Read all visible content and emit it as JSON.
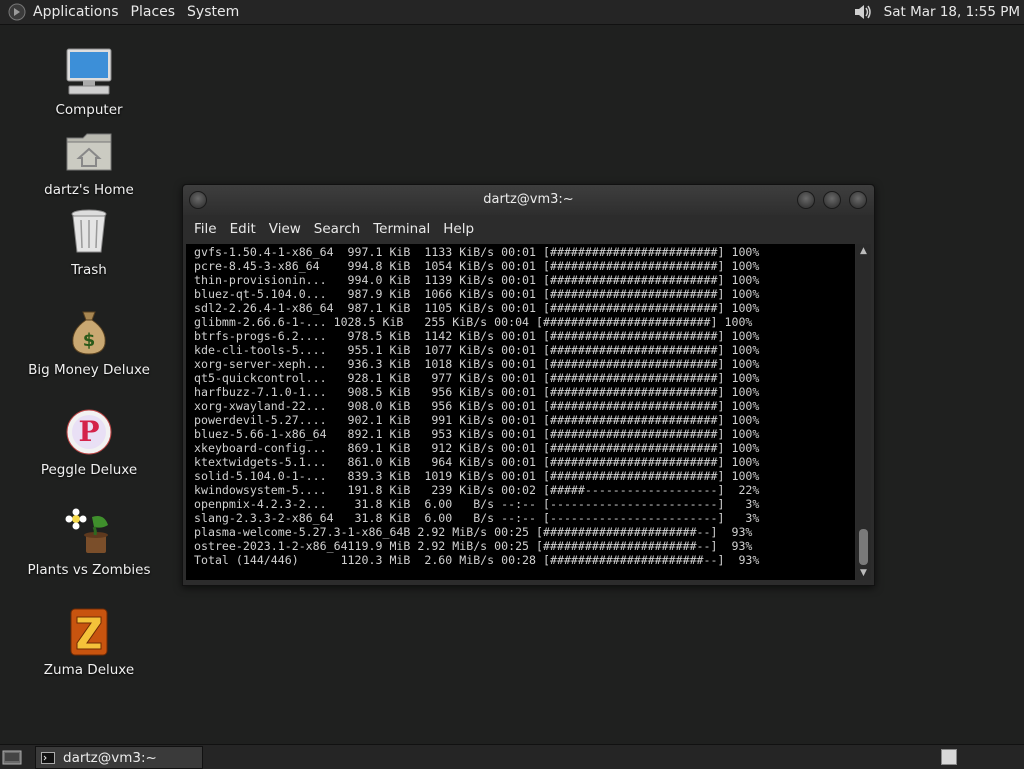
{
  "top_panel": {
    "menus": [
      "Applications",
      "Places",
      "System"
    ],
    "clock": "Sat Mar 18,  1:55 PM",
    "icons": [
      "foot-logo-icon",
      "volume-icon"
    ]
  },
  "desktop": {
    "icons": [
      {
        "label": "Computer",
        "icon": "computer-icon"
      },
      {
        "label": "dartz's Home",
        "icon": "home-folder-icon"
      },
      {
        "label": "Trash",
        "icon": "trash-icon"
      },
      {
        "label": "Big Money Deluxe",
        "icon": "money-bag-icon"
      },
      {
        "label": "Peggle Deluxe",
        "icon": "peggle-icon"
      },
      {
        "label": "Plants vs Zombies",
        "icon": "plants-vs-zombies-icon"
      },
      {
        "label": "Zuma Deluxe",
        "icon": "zuma-icon"
      }
    ]
  },
  "terminal": {
    "title": "dartz@vm3:~",
    "menus": [
      "File",
      "Edit",
      "View",
      "Search",
      "Terminal",
      "Help"
    ],
    "lines": [
      "gvfs-1.50.4-1-x86_64  997.1 KiB  1133 KiB/s 00:01 [########################] 100%",
      "pcre-8.45-3-x86_64    994.8 KiB  1054 KiB/s 00:01 [########################] 100%",
      "thin-provisionin...   994.0 KiB  1139 KiB/s 00:01 [########################] 100%",
      "bluez-qt-5.104.0...   987.9 KiB  1066 KiB/s 00:01 [########################] 100%",
      "sdl2-2.26.4-1-x86_64  987.1 KiB  1105 KiB/s 00:01 [########################] 100%",
      "glibmm-2.66.6-1-... 1028.5 KiB   255 KiB/s 00:04 [########################] 100%",
      "btrfs-progs-6.2....   978.5 KiB  1142 KiB/s 00:01 [########################] 100%",
      "kde-cli-tools-5....   955.1 KiB  1077 KiB/s 00:01 [########################] 100%",
      "xorg-server-xeph...   936.3 KiB  1018 KiB/s 00:01 [########################] 100%",
      "qt5-quickcontrol...   928.1 KiB   977 KiB/s 00:01 [########################] 100%",
      "harfbuzz-7.1.0-1...   908.5 KiB   956 KiB/s 00:01 [########################] 100%",
      "xorg-xwayland-22...   908.0 KiB   956 KiB/s 00:01 [########################] 100%",
      "powerdevil-5.27....   902.1 KiB   991 KiB/s 00:01 [########################] 100%",
      "bluez-5.66-1-x86_64   892.1 KiB   953 KiB/s 00:01 [########################] 100%",
      "xkeyboard-config...   869.1 KiB   912 KiB/s 00:01 [########################] 100%",
      "ktextwidgets-5.1...   861.0 KiB   964 KiB/s 00:01 [########################] 100%",
      "solid-5.104.0-1-...   839.3 KiB  1019 KiB/s 00:01 [########################] 100%",
      "kwindowsystem-5....   191.8 KiB   239 KiB/s 00:02 [#####-------------------]  22%",
      "openpmix-4.2.3-2...    31.8 KiB  6.00   B/s --:-- [------------------------]   3%",
      "slang-2.3.3-2-x86_64   31.8 KiB  6.00   B/s --:-- [------------------------]   3%",
      "plasma-welcome-5.27.3-1-x86_64B 2.92 MiB/s 00:25 [######################--]  93%",
      "ostree-2023.1-2-x86_64119.9 MiB 2.92 MiB/s 00:25 [######################--]  93%",
      "Total (144/446)      1120.3 MiB  2.60 MiB/s 00:28 [######################--]  93%"
    ]
  },
  "taskbar": {
    "task_label": "dartz@vm3:~",
    "icons": [
      "show-desktop-icon",
      "terminal-icon",
      "workspace-switcher"
    ]
  },
  "colors": {
    "desktop_bg": "#1f201f",
    "panel_bg": "#252525",
    "terminal_bg": "#000000",
    "terminal_fg": "#d0d0d0"
  }
}
